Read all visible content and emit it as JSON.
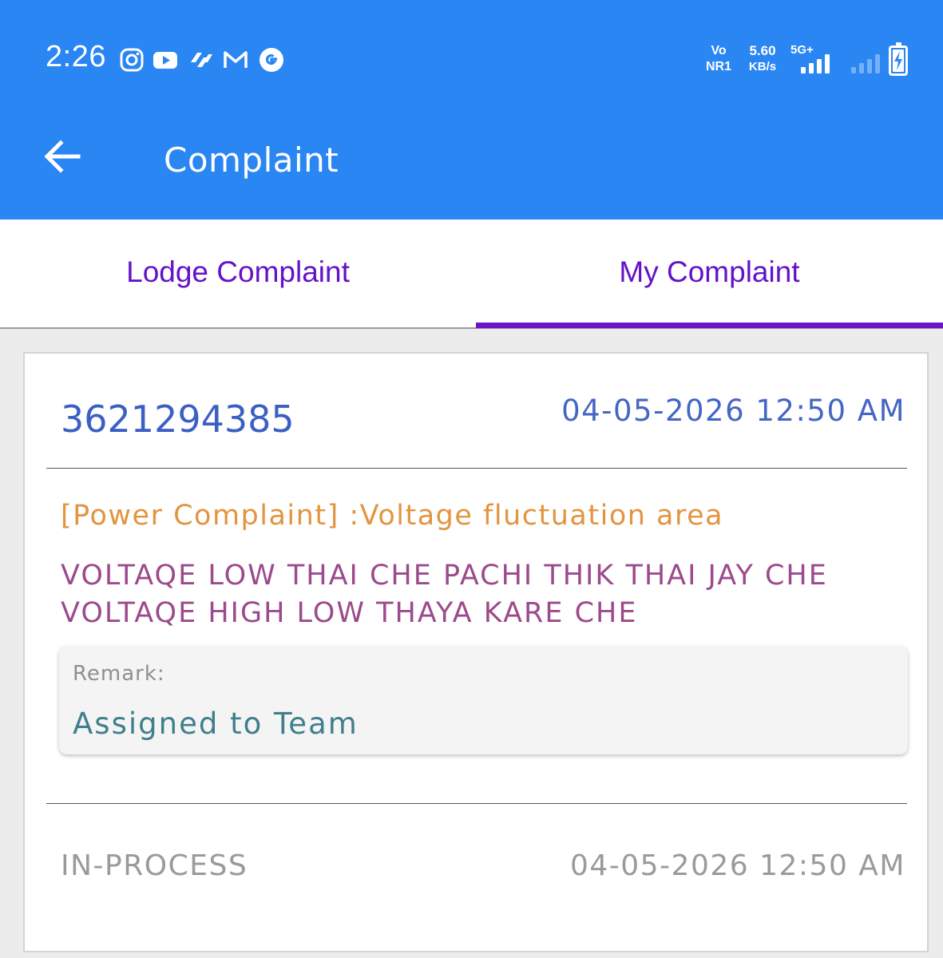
{
  "status_bar": {
    "time": "2:26",
    "notification_icons": [
      "instagram-icon",
      "youtube-icon",
      "paytm-icon",
      "gmail-icon",
      "google-icon"
    ],
    "volte_top": "Vo",
    "volte_bottom": "NR1",
    "speed_value": "5.60",
    "speed_unit": "KB/s",
    "network_type": "5G+",
    "accent_color": "#2a86f3"
  },
  "app_bar": {
    "back_icon": "arrow-left-icon",
    "title": "Complaint"
  },
  "tabs": [
    {
      "label": "Lodge Complaint",
      "selected": false
    },
    {
      "label": "My Complaint",
      "selected": true
    }
  ],
  "tab_colors": {
    "label": "#6412c8",
    "indicator": "#6a14cc"
  },
  "complaint": {
    "id": "3621294385",
    "date": "04-05-2026 12:50 AM",
    "type": "[Power Complaint] :Voltage fluctuation area",
    "description": "VOLTAQE LOW THAI CHE PACHI THIK THAI JAY CHE VOLTAQE HIGH LOW THAYA KARE CHE",
    "remark_label": "Remark:",
    "remark_value": "Assigned to Team",
    "status": "IN-PROCESS",
    "status_date": "04-05-2026 12:50 AM"
  }
}
